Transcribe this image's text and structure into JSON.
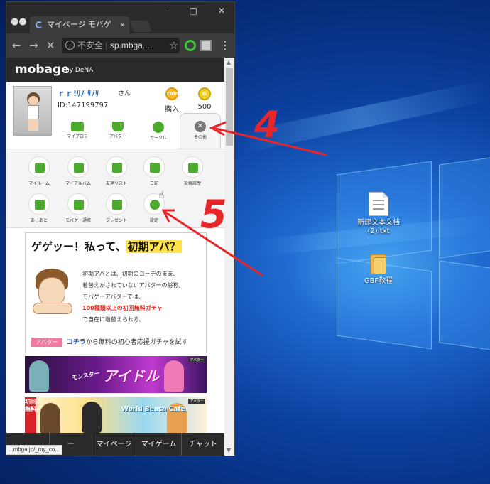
{
  "browser": {
    "tab_title": "マイページ モバゲ",
    "tab_close": "×",
    "url_security": "不安全",
    "url": "sp.mbga....",
    "status_url": "...mbga.jp/_my_co..."
  },
  "page": {
    "logo": "mobage",
    "logo_by": "by DeNA",
    "profile": {
      "name": "ｒｒ!ﾘﾉ ﾘﾉﾘ",
      "name_suffix": "さん",
      "id": "ID:147199797",
      "coin1_label": "購入",
      "coin1_text": "coin",
      "coin2_label": "500",
      "coin2_text": "G"
    },
    "profile_nav": [
      {
        "label": "マイプロフ"
      },
      {
        "label": "アバター"
      },
      {
        "label": "サークル"
      },
      {
        "label": "その他"
      }
    ],
    "menu": [
      {
        "label": "マイルーム"
      },
      {
        "label": "マイアルバム"
      },
      {
        "label": "友達リスト"
      },
      {
        "label": "日記"
      },
      {
        "label": "投稿履歴"
      },
      {
        "label": "あしあと"
      },
      {
        "label": "モバゲー通帳"
      },
      {
        "label": "プレゼント"
      },
      {
        "label": "設定"
      }
    ],
    "promo": {
      "title_part1": "ゲゲッー！私って、",
      "title_highlight": "初期アバ？",
      "line1": "初期アバとは、初期のコーデのまま、",
      "line2": "着替えがされていないアバターの俗称。",
      "line3": "モバゲーアバターでは、",
      "line4_red": "100種類以上の初回無料ガチャ",
      "line5": "で自在に着替えられる。",
      "tag": "アバター",
      "link": "コチラ",
      "foot_rest": "から無料の初心者応援ガチャを試す"
    },
    "banner1": {
      "title": "アイドル",
      "sub": "モンスター",
      "tag": "アバター"
    },
    "banner2": {
      "side": "初回無料",
      "title": "World Beach Cafe",
      "tag": "アバター"
    },
    "bottom_nav": [
      {
        "label": "ー"
      },
      {
        "label": "マイページ"
      },
      {
        "label": "マイゲーム"
      },
      {
        "label": "チャット"
      }
    ]
  },
  "desktop": {
    "icons": [
      {
        "label": "新建文本文档 (2).txt"
      },
      {
        "label": "GBF教程"
      }
    ]
  },
  "annotations": {
    "step4": "4",
    "step5": "5"
  }
}
